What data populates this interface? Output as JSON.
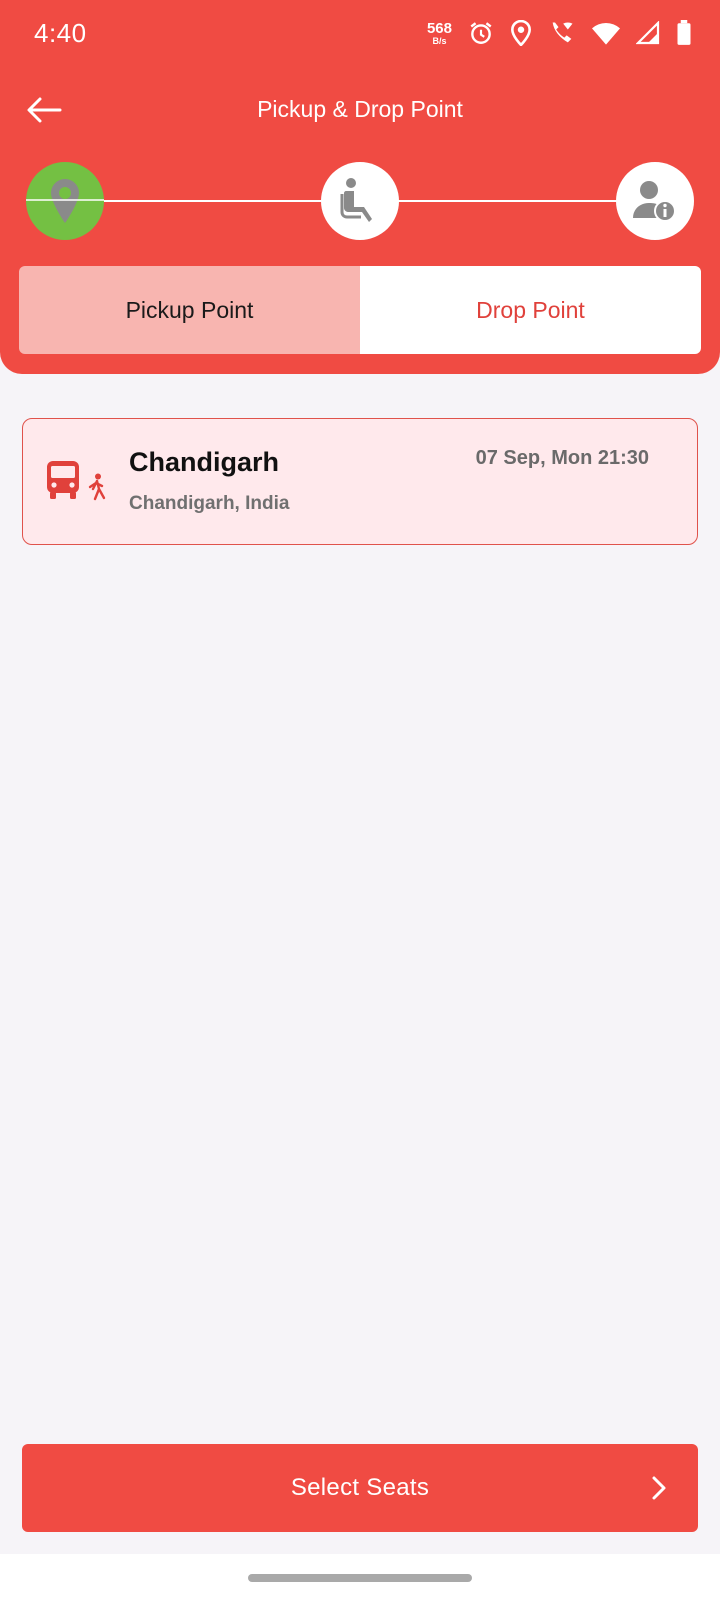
{
  "status_bar": {
    "time": "4:40",
    "net_speed_value": "568",
    "net_speed_unit": "B/s",
    "icons": [
      "alarm-icon",
      "location-icon",
      "wifi-call-icon",
      "wifi-icon",
      "signal-icon",
      "battery-icon"
    ]
  },
  "app_bar": {
    "title": "Pickup & Drop Point",
    "back_icon": "arrow-left-icon"
  },
  "stepper": {
    "steps": [
      {
        "icon": "location-pin-icon",
        "state": "active"
      },
      {
        "icon": "seat-icon",
        "state": "pending"
      },
      {
        "icon": "passenger-info-icon",
        "state": "pending"
      }
    ]
  },
  "tabs": [
    {
      "label": "Pickup Point",
      "selected": true
    },
    {
      "label": "Drop Point",
      "selected": false
    }
  ],
  "points": [
    {
      "name": "Chandigarh",
      "address": "Chandigarh, India",
      "datetime": "07 Sep, Mon 21:30",
      "icon": "bus-walk-icon"
    }
  ],
  "cta": {
    "label": "Select Seats",
    "icon": "chevron-right-icon"
  },
  "colors": {
    "primary": "#f04b43",
    "success": "#74c043",
    "card_bg": "#ffe9ec",
    "tab_selected_bg": "#f8b5b0",
    "page_bg": "#f6f4f8"
  }
}
